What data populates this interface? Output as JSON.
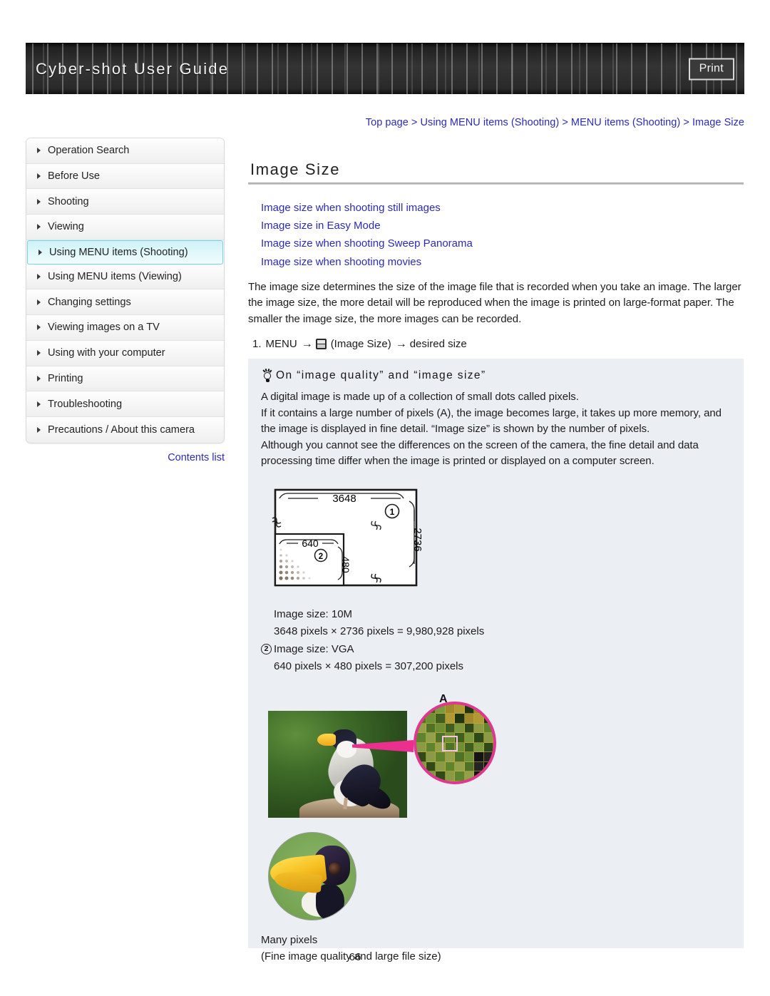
{
  "header": {
    "title": "Cyber-shot User Guide",
    "print_label": "Print"
  },
  "breadcrumb": {
    "text": "Top page > Using MENU items (Shooting) > MENU items (Shooting) > Image Size"
  },
  "sidebar": {
    "items": [
      {
        "label": "Operation Search",
        "active": false
      },
      {
        "label": "Before Use",
        "active": false
      },
      {
        "label": "Shooting",
        "active": false
      },
      {
        "label": "Viewing",
        "active": false
      },
      {
        "label": "Using MENU items (Shooting)",
        "active": true
      },
      {
        "label": "Using MENU items (Viewing)",
        "active": false
      },
      {
        "label": "Changing settings",
        "active": false
      },
      {
        "label": "Viewing images on a TV",
        "active": false
      },
      {
        "label": "Using with your computer",
        "active": false
      },
      {
        "label": "Printing",
        "active": false
      },
      {
        "label": "Troubleshooting",
        "active": false
      },
      {
        "label": "Precautions / About this camera",
        "active": false
      }
    ],
    "contents_list_label": "Contents list"
  },
  "main": {
    "title": "Image Size",
    "anchor_links": [
      "Image size when shooting still images",
      "Image size in Easy Mode",
      "Image size when shooting Sweep Panorama",
      "Image size when shooting movies"
    ],
    "intro_paragraph": "The image size determines the size of the image file that is recorded when you take an image. The larger the image size, the more detail will be reproduced when the image is printed on large-format paper. The smaller the image size, the more images can be recorded.",
    "step": {
      "number": "1.",
      "menu_label": "MENU",
      "arrow": "→",
      "icon_name": "image-size-menu-icon",
      "icon_label": "(Image Size)",
      "result": "desired size"
    }
  },
  "tip": {
    "heading": "On “image quality” and “image size”",
    "paragraphs": [
      "A digital image is made up of a collection of small dots called pixels.",
      "If it contains a large number of pixels (A), the image becomes large, it takes up more memory, and the image is displayed in fine detail. “Image size” is shown by the number of pixels.",
      "Although you cannot see the differences on the screen of the camera, the fine detail and data processing time differ when the image is printed or displayed on a computer screen."
    ],
    "diagram": {
      "outer_width_label": "3648",
      "outer_height_label": "2736",
      "outer_marker": "1",
      "inner_width_label": "640",
      "inner_height_label": "480",
      "inner_marker": "2"
    },
    "size_captions": [
      {
        "marker": "",
        "title": "Image size: 10M",
        "detail": "3648 pixels × 2736 pixels = 9,980,928 pixels"
      },
      {
        "marker": "2",
        "title": "Image size: VGA",
        "detail": "640 pixels × 480 pixels = 307,200 pixels"
      }
    ],
    "figure_a_label": "A",
    "figure_caption_line1": "Many pixels",
    "figure_caption_line2": "(Fine image quality and large file size)"
  },
  "footer": {
    "page_number": "66"
  },
  "colors": {
    "link": "#2b2bb5",
    "tip_background": "#ebeff4",
    "nav_active": "#ccf2f7",
    "accent_magenta": "#e0378f"
  }
}
